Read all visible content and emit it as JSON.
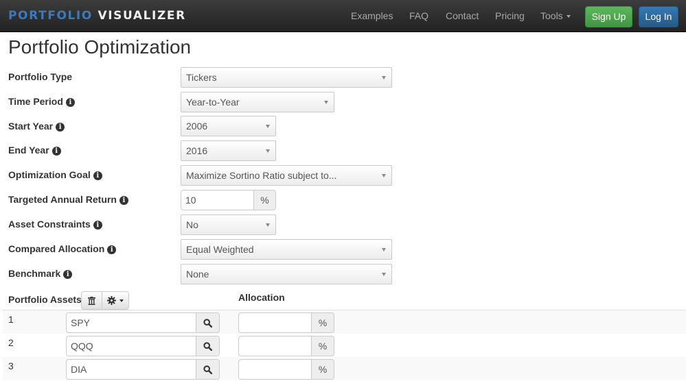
{
  "navbar": {
    "brand_part1": "PORTFOLIO",
    "brand_part2": "VISUALIZER",
    "links": [
      "Examples",
      "FAQ",
      "Contact",
      "Pricing",
      "Tools"
    ],
    "signup_label": "Sign Up",
    "login_label": "Log In",
    "colors": {
      "brand_accent": "#3a7bbf",
      "signup": "#5cb85c",
      "login": "#337ab7"
    }
  },
  "page": {
    "title": "Portfolio Optimization"
  },
  "form": {
    "portfolio_type": {
      "label": "Portfolio Type",
      "value": "Tickers"
    },
    "time_period": {
      "label": "Time Period",
      "value": "Year-to-Year"
    },
    "start_year": {
      "label": "Start Year",
      "value": "2006"
    },
    "end_year": {
      "label": "End Year",
      "value": "2016"
    },
    "optimization_goal": {
      "label": "Optimization Goal",
      "value": "Maximize Sortino Ratio subject to..."
    },
    "targeted_annual_return": {
      "label": "Targeted Annual Return",
      "value": "10",
      "unit": "%"
    },
    "asset_constraints": {
      "label": "Asset Constraints",
      "value": "No"
    },
    "compared_allocation": {
      "label": "Compared Allocation",
      "value": "Equal Weighted"
    },
    "benchmark": {
      "label": "Benchmark",
      "value": "None"
    }
  },
  "icons": {
    "info": "i",
    "trash": "trash-icon",
    "gear": "gear-icon",
    "search": "search-icon"
  },
  "assets": {
    "label": "Portfolio Assets",
    "allocation_header": "Allocation",
    "unit": "%",
    "rows": [
      {
        "num": "1",
        "ticker": "SPY",
        "allocation": ""
      },
      {
        "num": "2",
        "ticker": "QQQ",
        "allocation": ""
      },
      {
        "num": "3",
        "ticker": "DIA",
        "allocation": ""
      }
    ]
  }
}
